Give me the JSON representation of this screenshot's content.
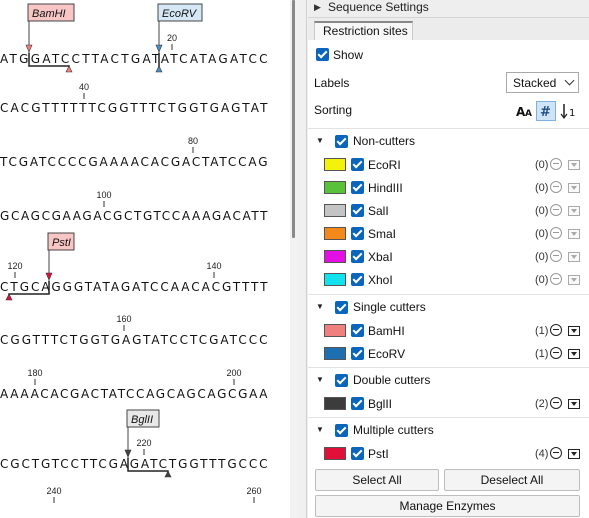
{
  "sequence_view": {
    "lines": [
      {
        "seq": "ATGGATCCTTACTGATATCATAGATCC",
        "ticks": [
          {
            "label": "20"
          }
        ]
      },
      {
        "seq": "CACGTTTTTTCGGTTTCTGGTGAGTAT",
        "ticks": [
          {
            "label": "40"
          }
        ]
      },
      {
        "seq": "TCGATCCCCGAAAACACGACTATCCAG",
        "ticks": [
          {
            "label": "80"
          }
        ]
      },
      {
        "seq": "GCAGCGAAGACGCTGTCCAAAGACATT",
        "ticks": [
          {
            "label": "100"
          }
        ]
      },
      {
        "seq": "CTGCAGGGTATAGATCCAACACGTTTT",
        "ticks": [
          {
            "label": "120"
          },
          {
            "label": "140"
          }
        ]
      },
      {
        "seq": "CGGTTTCTGGTGAGTATCCTCGATCCC",
        "ticks": [
          {
            "label": "160"
          }
        ]
      },
      {
        "seq": "AAAACACGACTATCCAGCAGCAGCGAA",
        "ticks": [
          {
            "label": "180"
          },
          {
            "label": "200"
          }
        ]
      },
      {
        "seq": "CGCTGTCCTTCGAGATCTGGTTTGCCC",
        "ticks": [
          {
            "label": "220"
          }
        ]
      },
      {
        "seq": "",
        "ticks": [
          {
            "label": "240"
          },
          {
            "label": "260"
          }
        ]
      }
    ],
    "sites": [
      {
        "name": "BamHI",
        "color": "#f08080"
      },
      {
        "name": "EcoRV",
        "color": "#4a90c8"
      },
      {
        "name": "PstI",
        "color": "#e0103a"
      },
      {
        "name": "BglII",
        "color": "#444444"
      }
    ]
  },
  "panel": {
    "section_title": "Sequence Settings",
    "tab_label": "Restriction sites",
    "show_label": "Show",
    "labels_label": "Labels",
    "labels_value": "Stacked",
    "sorting_label": "Sorting",
    "categories": [
      {
        "title": "Non-cutters",
        "enzymes": [
          {
            "name": "EcoRI",
            "count": "(0)",
            "color": "#f2f20a",
            "active": false
          },
          {
            "name": "HindIII",
            "count": "(0)",
            "color": "#5ac23a",
            "active": false
          },
          {
            "name": "SalI",
            "count": "(0)",
            "color": "#c4c4c4",
            "active": false
          },
          {
            "name": "SmaI",
            "count": "(0)",
            "color": "#f2891a",
            "active": false
          },
          {
            "name": "XbaI",
            "count": "(0)",
            "color": "#e210e2",
            "active": false
          },
          {
            "name": "XhoI",
            "count": "(0)",
            "color": "#12e2ee",
            "active": false
          }
        ]
      },
      {
        "title": "Single cutters",
        "enzymes": [
          {
            "name": "BamHI",
            "count": "(1)",
            "color": "#f08080",
            "active": true
          },
          {
            "name": "EcoRV",
            "count": "(1)",
            "color": "#1e6fb0",
            "active": true
          }
        ]
      },
      {
        "title": "Double cutters",
        "enzymes": [
          {
            "name": "BglII",
            "count": "(2)",
            "color": "#3c3c3c",
            "active": true
          }
        ]
      },
      {
        "title": "Multiple cutters",
        "enzymes": [
          {
            "name": "PstI",
            "count": "(4)",
            "color": "#e0103a",
            "active": true
          }
        ]
      }
    ],
    "select_all": "Select All",
    "deselect_all": "Deselect All",
    "manage_enzymes": "Manage Enzymes"
  }
}
